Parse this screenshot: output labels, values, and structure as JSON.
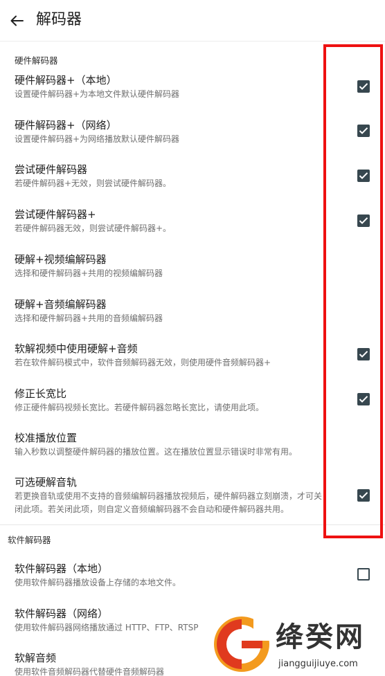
{
  "appbar": {
    "title": "解码器"
  },
  "hardware": {
    "header": "硬件解码器",
    "items": [
      {
        "title": "硬件解码器+（本地）",
        "summary": "设置硬件解码器+为本地文件默认硬件解码器",
        "checked": true
      },
      {
        "title": "硬件解码器+（网络）",
        "summary": "设置硬件解码器+为网络播放默认硬件解码器",
        "checked": true
      },
      {
        "title": "尝试硬件解码器",
        "summary": "若硬件解码器+无效，则尝试硬件解码器。",
        "checked": true
      },
      {
        "title": "尝试硬件解码器+",
        "summary": "若硬件解码器无效，则尝试硬件解码器+。",
        "checked": true
      },
      {
        "title": "硬解+视频编解码器",
        "summary": "选择和硬件解码器+共用的视频编解码器"
      },
      {
        "title": "硬解+音频编解码器",
        "summary": "选择和硬件解码器+共用的音频编解码器"
      },
      {
        "title": "软解视频中使用硬解+音频",
        "summary": "若在软件解码模式中，软件音频解码器无效，则使用硬件音频解码器+",
        "checked": true
      },
      {
        "title": "修正长宽比",
        "summary": "修正硬件解码视频长宽比。若硬件解码器忽略长宽比，请使用此项。",
        "checked": true
      },
      {
        "title": "校准播放位置",
        "summary": "输入秒数以调整硬件解码器的播放位置。这在播放位置显示错误时非常有用。"
      },
      {
        "title": "可选硬解音轨",
        "summary": "若更换音轨或使用不支持的音频编解码器播放视频后，硬件解码器立刻崩溃，才可关闭此项。若关闭此项，则自定义音频编解码器不会自动和硬件解码器共用。",
        "checked": true
      }
    ]
  },
  "software": {
    "header": "软件解码器",
    "items": [
      {
        "title": "软件解码器（本地）",
        "summary": "使用软件解码器播放设备上存储的本地文件。",
        "checked": false
      },
      {
        "title": "软件解码器（网络）",
        "summary": "使用软件解码器网络播放通过 HTTP、FTP、RTSP"
      },
      {
        "title": "软解音频",
        "summary": "使用软件音频解码器代替硬件音频解码器"
      }
    ]
  },
  "watermark": {
    "name": "绛癸网",
    "url": "jiangguijiuye.com"
  },
  "colors": {
    "checkbox": "#37474f",
    "highlight": "#ee1111"
  }
}
